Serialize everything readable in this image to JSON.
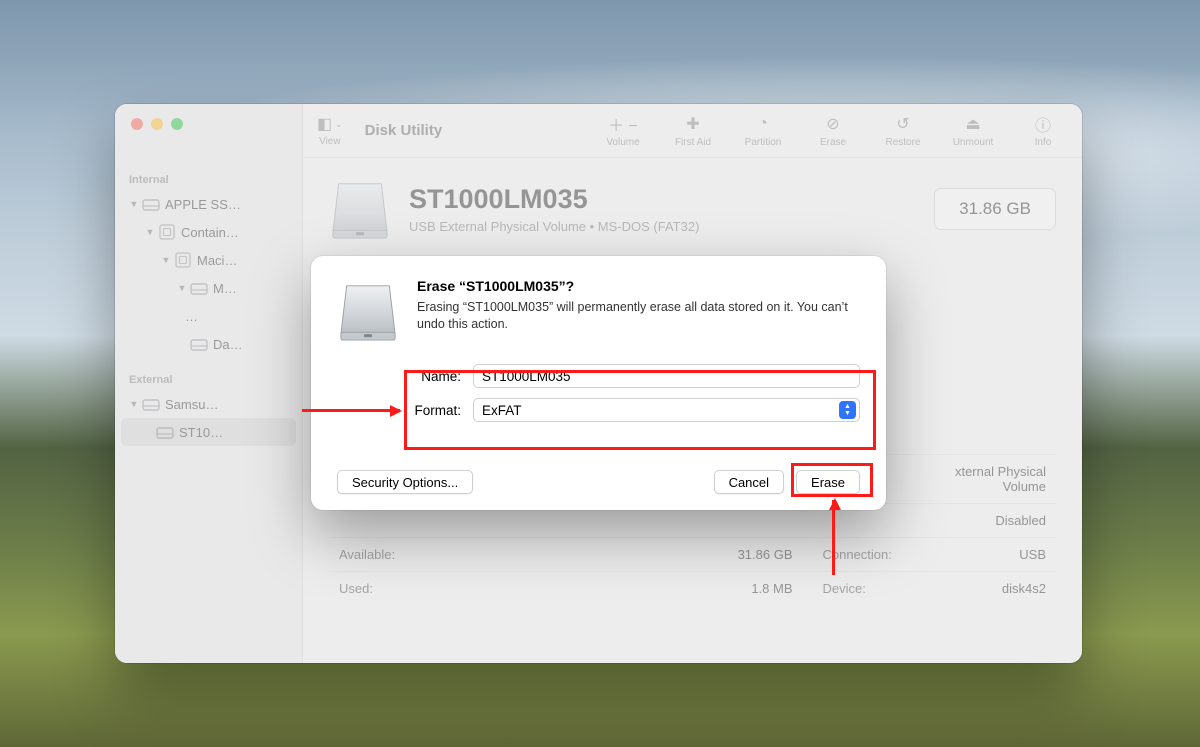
{
  "app": {
    "title": "Disk Utility",
    "view_label": "View"
  },
  "toolbar": {
    "volume": "Volume",
    "first_aid": "First Aid",
    "partition": "Partition",
    "erase": "Erase",
    "restore": "Restore",
    "unmount": "Unmount",
    "info": "Info"
  },
  "sidebar": {
    "internal": "Internal",
    "external": "External",
    "items": {
      "apple_ssd": "APPLE SS…",
      "container": "Contain…",
      "macintosh": "Maci…",
      "m_sub": "M…",
      "dots": "…",
      "data": "Da…",
      "samsung": "Samsu…",
      "st10": "ST10…"
    }
  },
  "volume": {
    "title": "ST1000LM035",
    "subtitle": "USB External Physical Volume • MS-DOS (FAT32)",
    "size": "31.86 GB"
  },
  "details": {
    "available_k": "Available:",
    "available_v": "31.86 GB",
    "used_k": "Used:",
    "used_v": "1.8 MB",
    "type_v": "xternal Physical Volume",
    "owners_v": "Disabled",
    "connection_k": "Connection:",
    "connection_v": "USB",
    "device_k": "Device:",
    "device_v": "disk4s2"
  },
  "dialog": {
    "title": "Erase “ST1000LM035”?",
    "body": "Erasing “ST1000LM035” will permanently erase all data stored on it. You can’t undo this action.",
    "name_label": "Name:",
    "name_value": "ST1000LM035",
    "format_label": "Format:",
    "format_value": "ExFAT",
    "security": "Security Options...",
    "cancel": "Cancel",
    "erase": "Erase"
  }
}
